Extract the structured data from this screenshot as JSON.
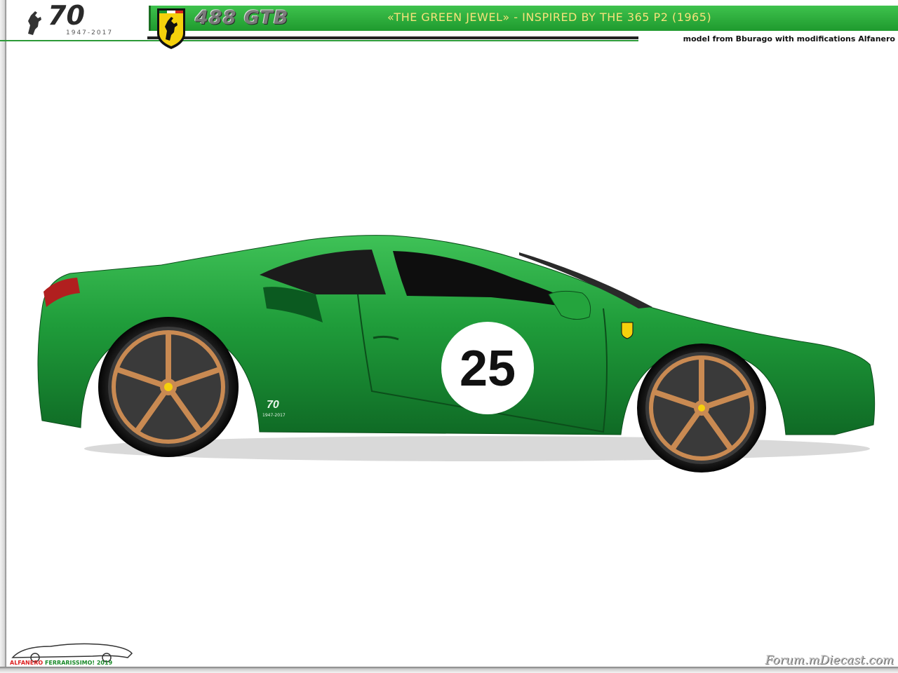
{
  "header": {
    "anniversary_number": "70",
    "anniversary_years": "1947-2017",
    "model_name": "488 GTB",
    "subtitle": "«THE GREEN JEWEL» - INSPIRED BY THE 365 P2 (1965)",
    "credit": "model from Bburago with modifications Alfanero"
  },
  "car": {
    "race_number": "25",
    "badge_number": "70",
    "badge_years": "1947-2017",
    "body_color": "#1f9c3a",
    "wheel_color": "#c98a52"
  },
  "footer": {
    "logo_text_part1": "ALFANERO",
    "logo_text_part2": "FERRARISSIMO! 2019",
    "watermark": "Forum.mDiecast.com"
  },
  "colors": {
    "accent_green": "#2fb341",
    "subtitle_yellow": "#f6e27a"
  }
}
